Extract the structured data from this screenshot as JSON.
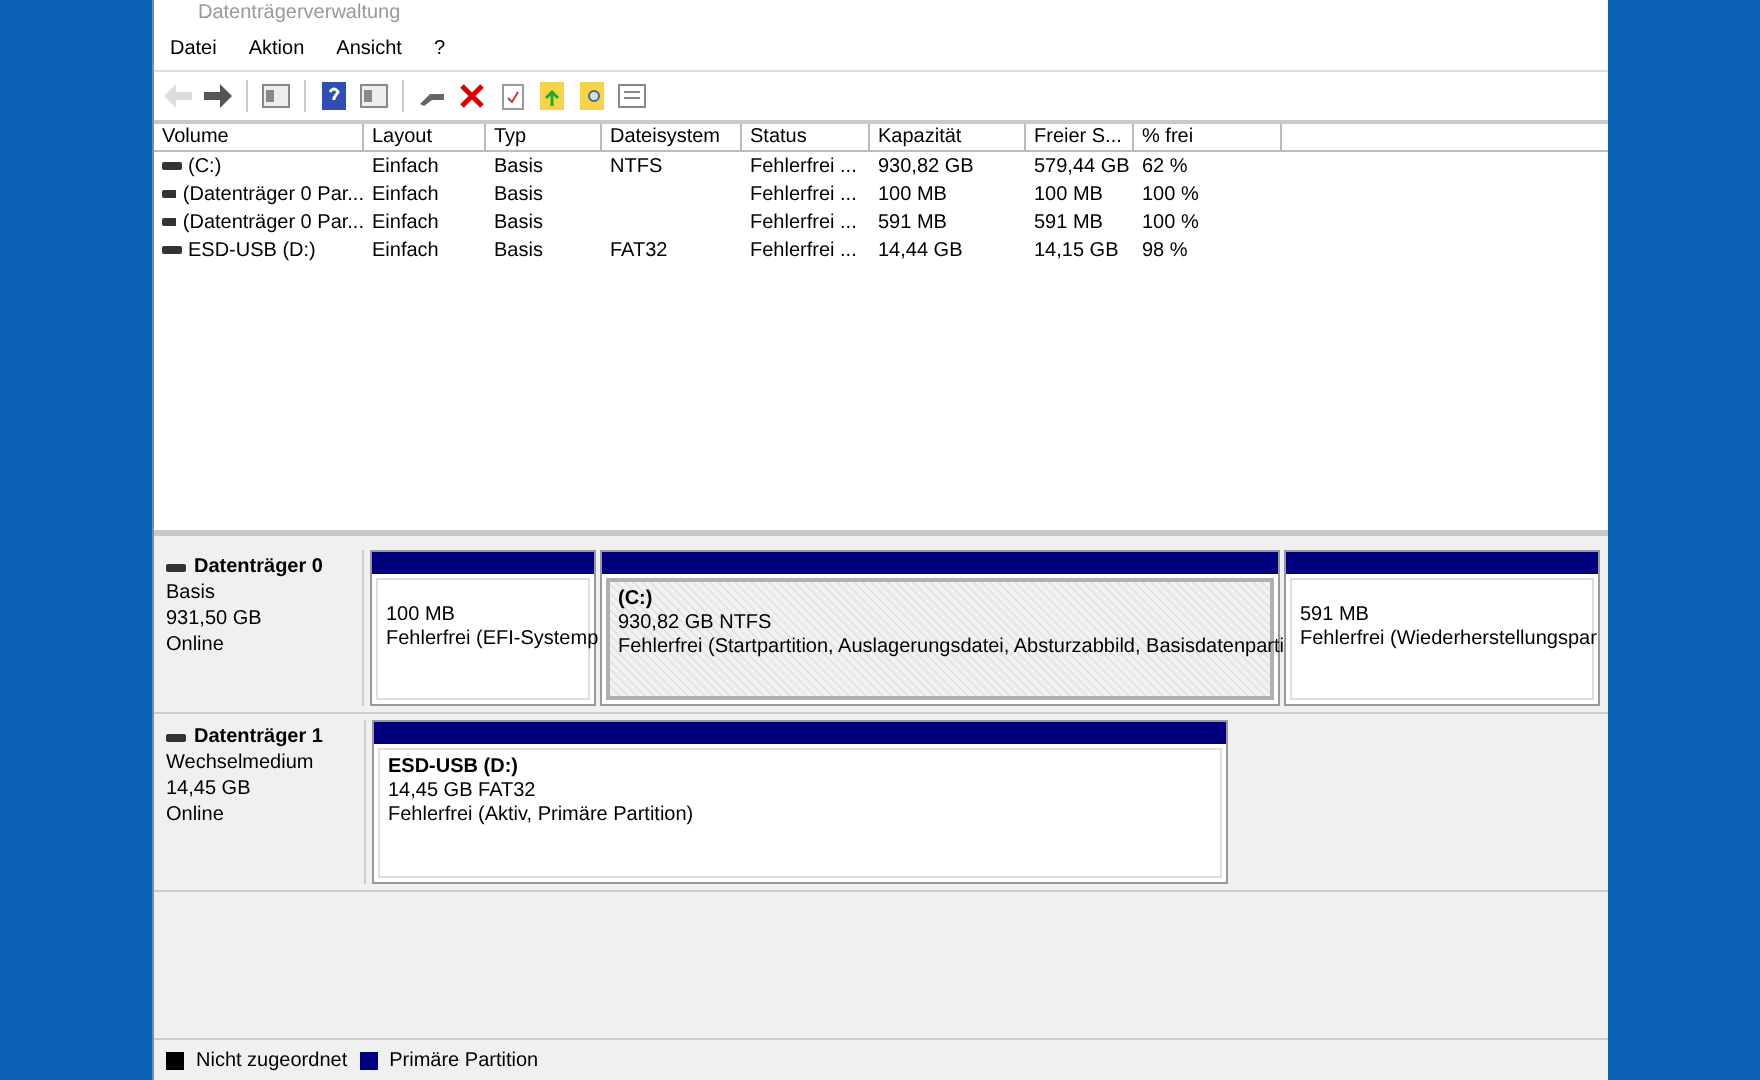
{
  "window": {
    "title": "Datenträgerverwaltung"
  },
  "menu": [
    "Datei",
    "Aktion",
    "Ansicht",
    "?"
  ],
  "toolbar": [
    {
      "kind": "back",
      "disabled": true
    },
    {
      "kind": "forward",
      "disabled": false
    },
    {
      "kind": "pane",
      "disabled": false
    },
    {
      "kind": "help",
      "disabled": false
    },
    {
      "kind": "pane",
      "disabled": false
    },
    {
      "kind": "connect",
      "disabled": false
    },
    {
      "kind": "delete",
      "disabled": false
    },
    {
      "kind": "check",
      "disabled": false
    },
    {
      "kind": "folder-up",
      "disabled": false
    },
    {
      "kind": "folder-search",
      "disabled": false
    },
    {
      "kind": "list",
      "disabled": false
    }
  ],
  "table": {
    "columns": [
      "Volume",
      "Layout",
      "Typ",
      "Dateisystem",
      "Status",
      "Kapazität",
      "Freier S...",
      "% frei"
    ],
    "rows": [
      [
        "(C:)",
        "Einfach",
        "Basis",
        "NTFS",
        "Fehlerfrei ...",
        "930,82 GB",
        "579,44 GB",
        "62 %"
      ],
      [
        "(Datenträger 0 Par...",
        "Einfach",
        "Basis",
        "",
        "Fehlerfrei ...",
        "100 MB",
        "100 MB",
        "100 %"
      ],
      [
        "(Datenträger 0 Par...",
        "Einfach",
        "Basis",
        "",
        "Fehlerfrei ...",
        "591 MB",
        "591 MB",
        "100 %"
      ],
      [
        "ESD-USB (D:)",
        "Einfach",
        "Basis",
        "FAT32",
        "Fehlerfrei ...",
        "14,44 GB",
        "14,15 GB",
        "98 %"
      ]
    ]
  },
  "disks": [
    {
      "name": "Datenträger 0",
      "type": "Basis",
      "size": "931,50 GB",
      "state": "Online",
      "partitions": [
        {
          "size": "100 MB",
          "status": "Fehlerfrei (EFI-Systemp",
          "selected": false
        },
        {
          "label": "(C:)",
          "size": "930,82 GB NTFS",
          "status": "Fehlerfrei (Startpartition, Auslagerungsdatei, Absturzabbild, Basisdatenparti",
          "selected": true
        },
        {
          "size": "591 MB",
          "status": "Fehlerfrei (Wiederherstellungspar",
          "selected": false
        }
      ]
    },
    {
      "name": "Datenträger 1",
      "type": "Wechselmedium",
      "size": "14,45 GB",
      "state": "Online",
      "partitions": [
        {
          "label": "ESD-USB  (D:)",
          "size": "14,45 GB FAT32",
          "status": "Fehlerfrei (Aktiv, Primäre Partition)",
          "selected": false
        }
      ]
    }
  ],
  "legend": [
    {
      "label": "Nicht zugeordnet",
      "color": "#000000"
    },
    {
      "label": "Primäre Partition",
      "color": "#00007f"
    }
  ]
}
